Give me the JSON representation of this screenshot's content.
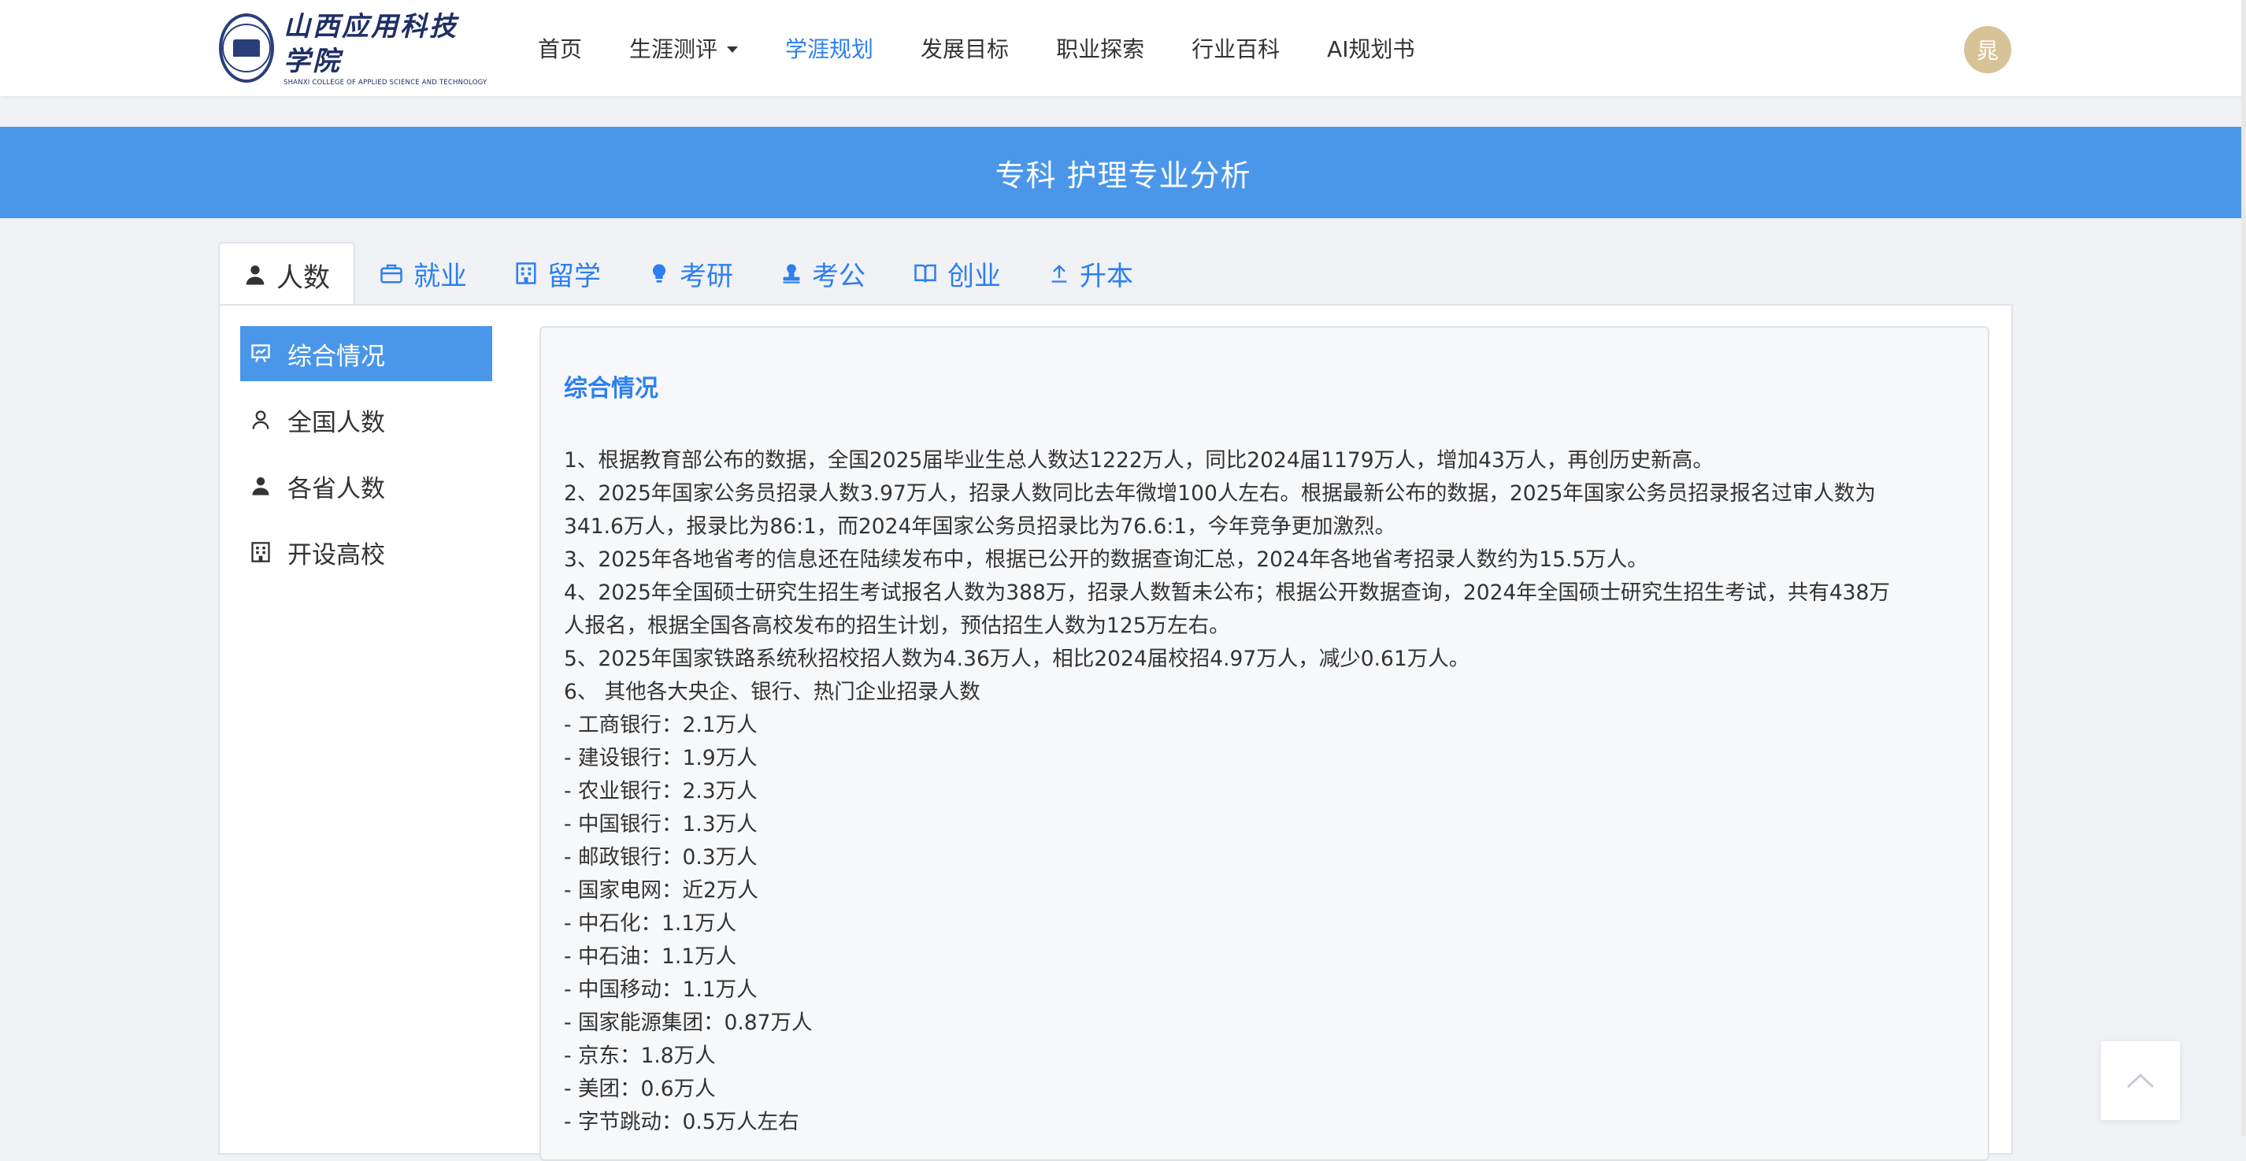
{
  "app": {
    "logo_cn": "山西应用科技学院",
    "logo_en": "SHANXI COLLEGE OF APPLIED SCIENCE AND TECHNOLOGY",
    "nav": [
      {
        "label": "首页"
      },
      {
        "label": "生涯测评"
      },
      {
        "label": "学涯规划"
      },
      {
        "label": "发展目标"
      },
      {
        "label": "职业探索"
      },
      {
        "label": "行业百科"
      },
      {
        "label": "AI规划书"
      }
    ],
    "active_nav": "学涯规划",
    "avatar_text": "晁"
  },
  "banner": {
    "title": "专科 护理专业分析"
  },
  "tabs": [
    {
      "label": "人数",
      "icon": "person-icon"
    },
    {
      "label": "就业",
      "icon": "briefcase-icon"
    },
    {
      "label": "留学",
      "icon": "building-icon"
    },
    {
      "label": "考研",
      "icon": "lightbulb-icon"
    },
    {
      "label": "考公",
      "icon": "stamp-icon"
    },
    {
      "label": "创业",
      "icon": "book-open-icon"
    },
    {
      "label": "升本",
      "icon": "upload-icon"
    }
  ],
  "side_menu": [
    {
      "label": "综合情况",
      "icon": "presentation-icon"
    },
    {
      "label": "全国人数",
      "icon": "person-outline-icon"
    },
    {
      "label": "各省人数",
      "icon": "person-icon"
    },
    {
      "label": "开设高校",
      "icon": "building-icon"
    }
  ],
  "content": {
    "title": "综合情况",
    "lines": [
      "1、根据教育部公布的数据，全国2025届毕业生总人数达1222万人，同比2024届1179万人，增加43万人，再创历史新高。",
      "2、2025年国家公务员招录人数3.97万人，招录人数同比去年微增100人左右。根据最新公布的数据，2025年国家公务员招录报名过审人数为",
      "341.6万人，报录比为86:1，而2024年国家公务员招录比为76.6:1，今年竞争更加激烈。",
      "3、2025年各地省考的信息还在陆续发布中，根据已公开的数据查询汇总，2024年各地省考招录人数约为15.5万人。",
      "4、2025年全国硕士研究生招生考试报名人数为388万，招录人数暂未公布；根据公开数据查询，2024年全国硕士研究生招生考试，共有438万",
      "人报名，根据全国各高校发布的招生计划，预估招生人数为125万左右。",
      "5、2025年国家铁路系统秋招校招人数为4.36万人，相比2024届校招4.97万人，减少0.61万人。",
      "6、 其他各大央企、银行、热门企业招录人数",
      "- 工商银行：2.1万人",
      "- 建设银行：1.9万人",
      "- 农业银行：2.3万人",
      "- 中国银行：1.3万人",
      "- 邮政银行：0.3万人",
      "- 国家电网：近2万人",
      "- 中石化：1.1万人",
      "- 中石油：1.1万人",
      "- 中国移动：1.1万人",
      "- 国家能源集团：0.87万人",
      "- 京东：1.8万人",
      "- 美团：0.6万人",
      "- 字节跳动：0.5万人左右"
    ]
  },
  "colors": {
    "accent": "#2d7ff0",
    "banner": "#4a97ea",
    "avatar": "#d8c298"
  }
}
